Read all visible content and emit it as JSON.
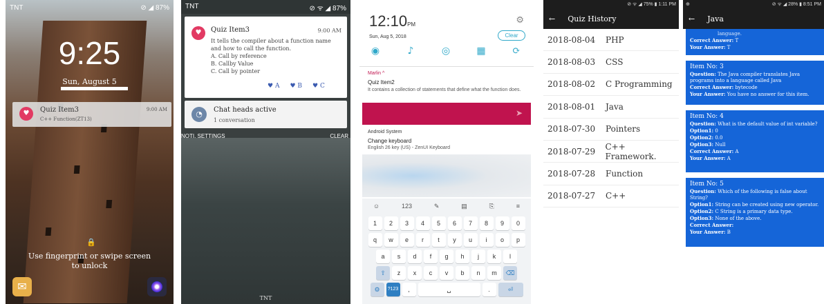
{
  "s1": {
    "carrier": "TNT",
    "status": "⊘ ◢ 87%",
    "time": "9:25",
    "date": "Sun, August 5",
    "notif_icon": "quiz-app-icon",
    "notif_title": "Quiz Item3",
    "notif_sub": "C++ Function(ZT13)",
    "notif_time": "9:00 AM",
    "lock_icon": "🔒",
    "hint_line1": "Use fingerprint or swipe screen",
    "hint_line2": "to unlock"
  },
  "s2": {
    "carrier": "TNT",
    "status": "⊘ ᯤ ◢ 87%",
    "title": "Quiz Item3",
    "time": "9:00 AM",
    "body": [
      "It tells the compiler about a function name and how to call the function.",
      "A. Call by reference",
      "B. Callby Value",
      "C. Call by pointer"
    ],
    "actions": [
      "A",
      "B",
      "C"
    ],
    "chat_title": "Chat heads active",
    "chat_sub": "1 conversation",
    "notif_settings": "NOTI. SETTINGS",
    "clear": "CLEAR",
    "bottom_carrier": "TNT"
  },
  "s3": {
    "time": "12:10",
    "ampm": "PM",
    "date": "Sun, Aug 5, 2018",
    "clear": "Clear",
    "app_name": "Marlin ^",
    "notif_title": "Quiz Item2",
    "notif_body": "It contains a collection of statements that define what the function does.",
    "sys_name": "Android System",
    "kb_title": "Change keyboard",
    "kb_sub": "English 26 key (US) - ZenUI Keyboard",
    "toolbar": [
      "☺",
      "123",
      "✎",
      "▤",
      "⎘",
      "≡"
    ],
    "row1": [
      "1",
      "2",
      "3",
      "4",
      "5",
      "6",
      "7",
      "8",
      "9",
      "0"
    ],
    "row2": [
      "q",
      "w",
      "e",
      "r",
      "t",
      "y",
      "u",
      "i",
      "o",
      "p"
    ],
    "row3": [
      "a",
      "s",
      "d",
      "f",
      "g",
      "h",
      "j",
      "k",
      "l"
    ],
    "row4": [
      "⇧",
      "z",
      "x",
      "c",
      "v",
      "b",
      "n",
      "m",
      "⌫"
    ],
    "row5": [
      "⚙",
      "?123",
      ",",
      "␣",
      ".",
      "⏎"
    ]
  },
  "s4": {
    "status": "⊘ ᯤ ◢ 75% ▮ 1:11 PM",
    "title": "Quiz History",
    "rows": [
      {
        "date": "2018-08-04",
        "topic": "PHP"
      },
      {
        "date": "2018-08-03",
        "topic": "CSS"
      },
      {
        "date": "2018-08-02",
        "topic": "C Programming"
      },
      {
        "date": "2018-08-01",
        "topic": "Java"
      },
      {
        "date": "2018-07-30",
        "topic": "Pointers"
      },
      {
        "date": "2018-07-29",
        "topic": "C++ Framework."
      },
      {
        "date": "2018-07-28",
        "topic": "Function"
      },
      {
        "date": "2018-07-27",
        "topic": "C++"
      }
    ]
  },
  "s5": {
    "status_left": "⊕",
    "status_right": "⊘ ᯤ ◢ 28% ▮ 8:51 PM",
    "title": "Java",
    "box0": {
      "frag": "language.",
      "correct": "T",
      "yours": "T"
    },
    "box3": {
      "item": "Item No:  3",
      "question": "The Java compiler translates Java programs into a language called Java",
      "correct": "bytecode",
      "yours": "You have no answer for this item."
    },
    "box4": {
      "item": "Item No:  4",
      "question": "What is the default value of int variable?",
      "opt1": "0",
      "opt2": "0.0",
      "opt3": "Null",
      "correct": "A",
      "yours": "A"
    },
    "box5": {
      "item": "Item No:  5",
      "question": "Which of the following is false about String?",
      "opt1": "String can be created using new operator.",
      "opt2": "C String is a primary data type.",
      "opt3": "None of the above.",
      "correct": "",
      "yours": "B"
    },
    "labels": {
      "question": "Question:",
      "option1": "Option1:",
      "option2": "Option2:",
      "option3": "Option3:",
      "correct": "Correct Answer:",
      "yours": "Your Answer:"
    }
  }
}
